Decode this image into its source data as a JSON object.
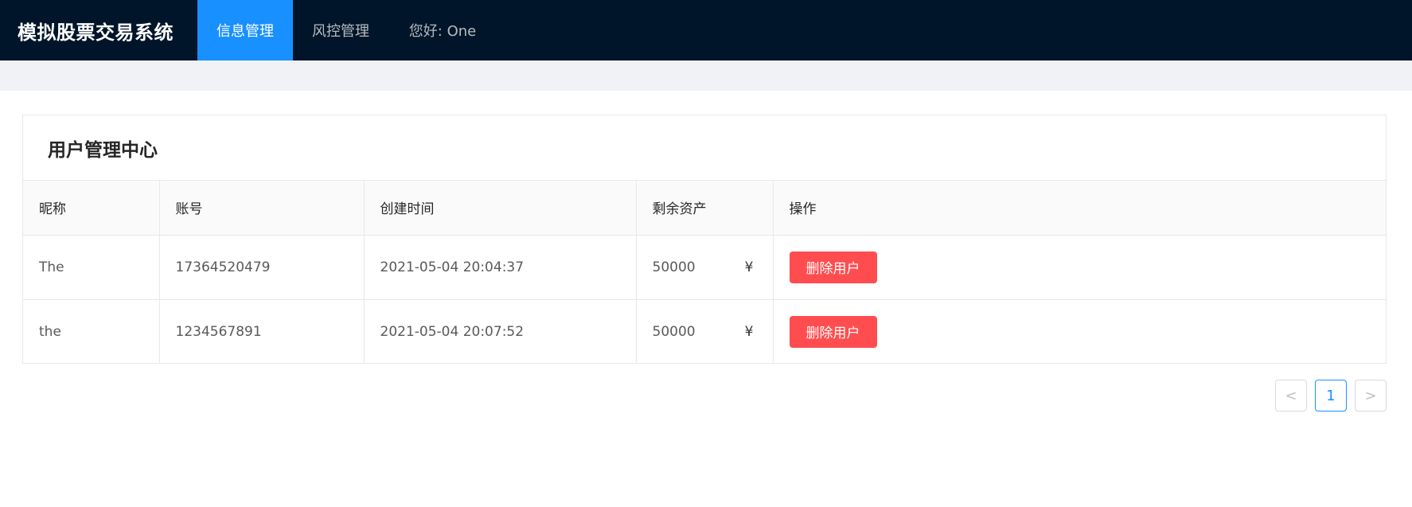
{
  "app": {
    "title": "模拟股票交易系统"
  },
  "nav": {
    "items": [
      {
        "label": "信息管理",
        "active": true
      },
      {
        "label": "风控管理",
        "active": false
      },
      {
        "label": "您好: One",
        "active": false
      }
    ]
  },
  "card": {
    "title": "用户管理中心"
  },
  "table": {
    "columns": [
      "昵称",
      "账号",
      "创建时间",
      "剩余资产",
      "操作"
    ],
    "currency_symbol": "¥",
    "rows": [
      {
        "nickname": "The",
        "account": "17364520479",
        "created": "2021-05-04 20:04:37",
        "assets": "50000",
        "action": "删除用户"
      },
      {
        "nickname": "the",
        "account": "1234567891",
        "created": "2021-05-04 20:07:52",
        "assets": "50000",
        "action": "删除用户"
      }
    ]
  },
  "pagination": {
    "prev": "<",
    "current": "1",
    "next": ">"
  },
  "colors": {
    "header_bg": "#001529",
    "active_nav": "#1890ff",
    "danger": "#ff4d4f"
  }
}
